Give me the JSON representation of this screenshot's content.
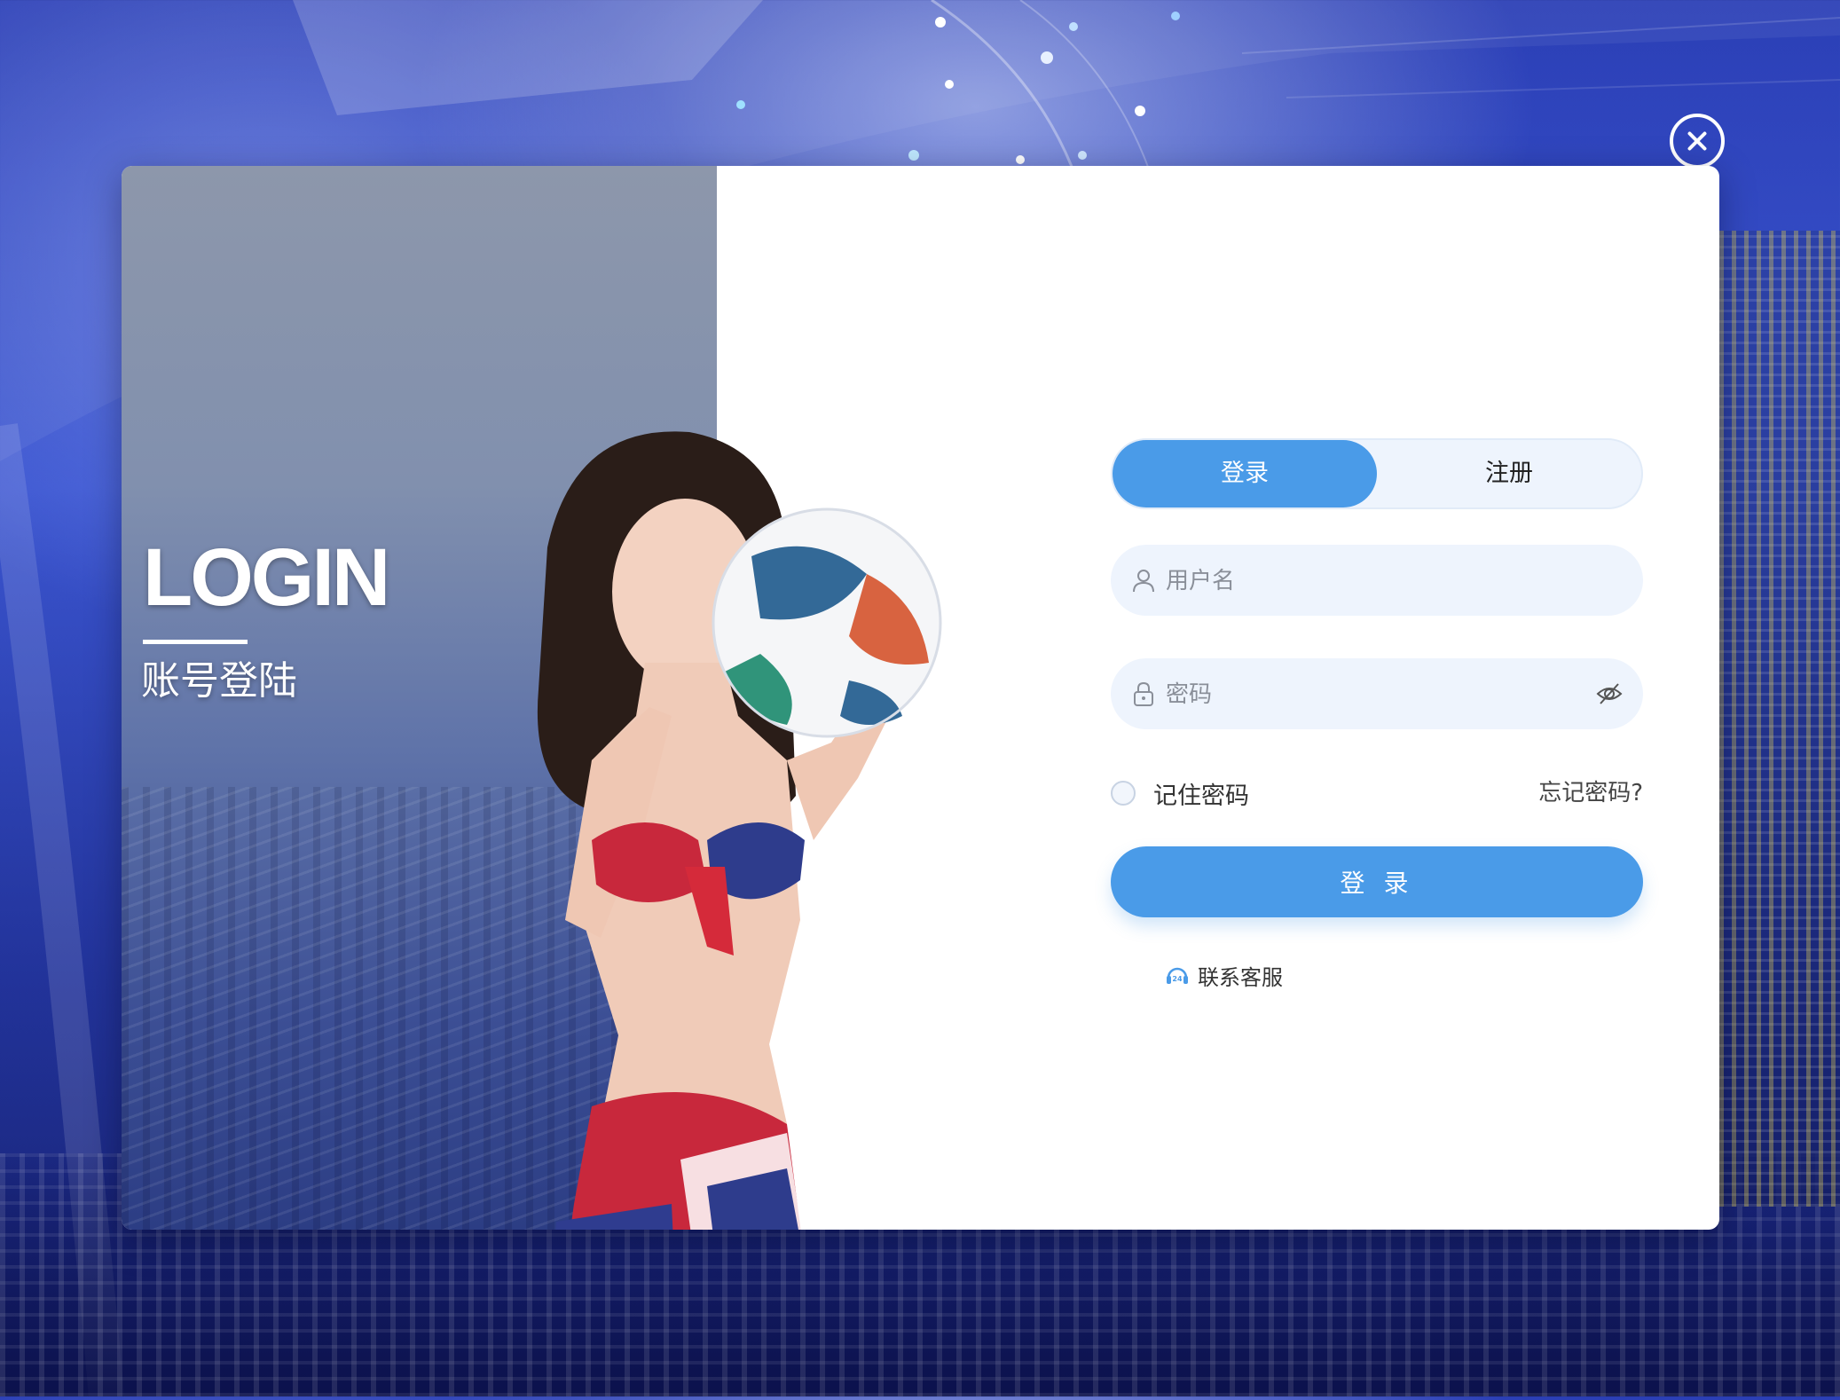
{
  "brand": {
    "accent_color": "#4a9be8",
    "field_bg": "#eef4fd"
  },
  "hero": {
    "heading": "LOGIN",
    "subheading": "账号登陆",
    "image": "model-holding-soccer-ball"
  },
  "tabs": [
    {
      "label": "登录",
      "active": true
    },
    {
      "label": "注册",
      "active": false
    }
  ],
  "form": {
    "username": {
      "placeholder": "用户名",
      "value": "",
      "icon": "user-icon"
    },
    "password": {
      "placeholder": "密码",
      "value": "",
      "icon": "lock-icon",
      "toggle_icon": "eye-off-icon"
    },
    "remember_label": "记住密码",
    "remember_checked": false,
    "forgot_label": "忘记密码?",
    "submit_label": "登 录"
  },
  "support": {
    "label": "联系客服",
    "icon": "headset-24-icon"
  },
  "close_icon": "close-icon"
}
